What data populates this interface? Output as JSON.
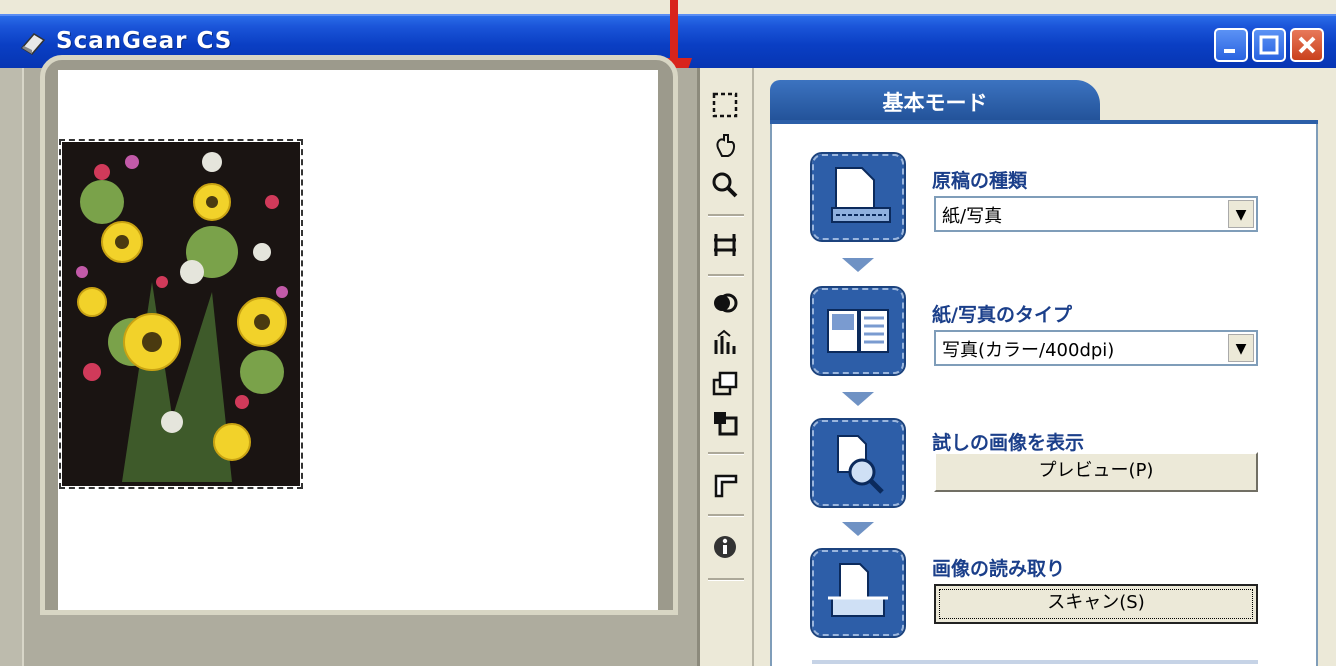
{
  "window": {
    "title": "ScanGear CS",
    "controls": [
      "minimize",
      "maximize",
      "close"
    ]
  },
  "toolbar": {
    "tools": [
      "select-area-icon",
      "hand-icon",
      "zoom-icon",
      "crop-fit-icon",
      "color-balance-icon",
      "brightness-icon",
      "tone-curve-icon",
      "threshold-icon",
      "auto-crop-icon",
      "info-icon"
    ]
  },
  "tab": {
    "label": "基本モード"
  },
  "steps": {
    "source_type": {
      "label": "原稿の種類",
      "value": "紙/写真"
    },
    "paper_type": {
      "label": "紙/写真のタイプ",
      "value": "写真(カラー/400dpi)"
    },
    "preview": {
      "label": "試しの画像を表示",
      "button": "プレビュー(P)"
    },
    "scan": {
      "label": "画像の読み取り",
      "button": "スキャン(S)"
    }
  },
  "colors": {
    "titlebar": "#0a3fc4",
    "accent": "#2d5ea8",
    "arrow": "#d8241c"
  }
}
